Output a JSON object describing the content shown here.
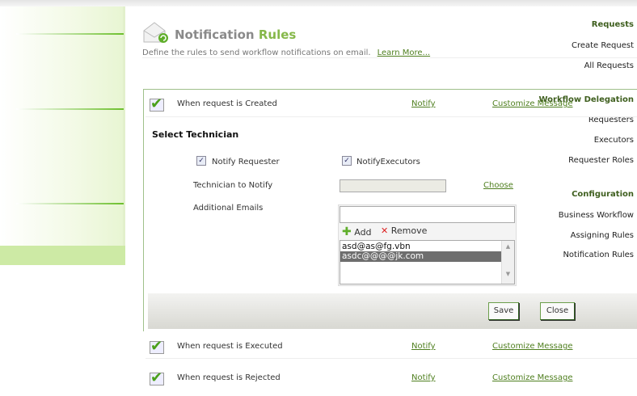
{
  "sidebar": {
    "sections": [
      {
        "header": "Requests",
        "items": [
          "Create Request",
          "All Requests"
        ]
      },
      {
        "header": "Workflow Delegation",
        "items": [
          "Requesters",
          "Executors",
          "Requester Roles"
        ]
      },
      {
        "header": "Configuration",
        "items": [
          "Business Workflow",
          "Assigning Rules",
          "Notification Rules"
        ]
      }
    ],
    "selected": "Notification Rules"
  },
  "header": {
    "title_part1": "Notification",
    "title_part2": "Rules",
    "subtitle": "Define the rules to send workflow notifications on email.",
    "learn_more": "Learn More..."
  },
  "rules": [
    {
      "label": "When request is Created",
      "notify": "Notify",
      "customize": "Customize Message",
      "checked": true
    },
    {
      "label": "When request is Executed",
      "notify": "Notify",
      "customize": "Customize Message",
      "checked": true
    },
    {
      "label": "When request is Rejected",
      "notify": "Notify",
      "customize": "Customize Message",
      "checked": true
    }
  ],
  "form": {
    "section_title": "Select Technician",
    "notify_requester": "Notify Requester",
    "notify_executors": "NotifyExecutors",
    "technician_label": "Technician to Notify",
    "technician_value": "",
    "choose": "Choose",
    "emails_label": "Additional Emails",
    "email_input": "",
    "add": "Add",
    "remove": "Remove",
    "emails": [
      "asd@as@fg.vbn",
      "asdc@@@@jk.com"
    ],
    "selected_email": "asdc@@@@jk.com",
    "save": "Save",
    "close": "Close"
  },
  "colors": {
    "accent": "#86b84a",
    "link": "#4f7f1f",
    "selected": "#cdeaa5"
  }
}
